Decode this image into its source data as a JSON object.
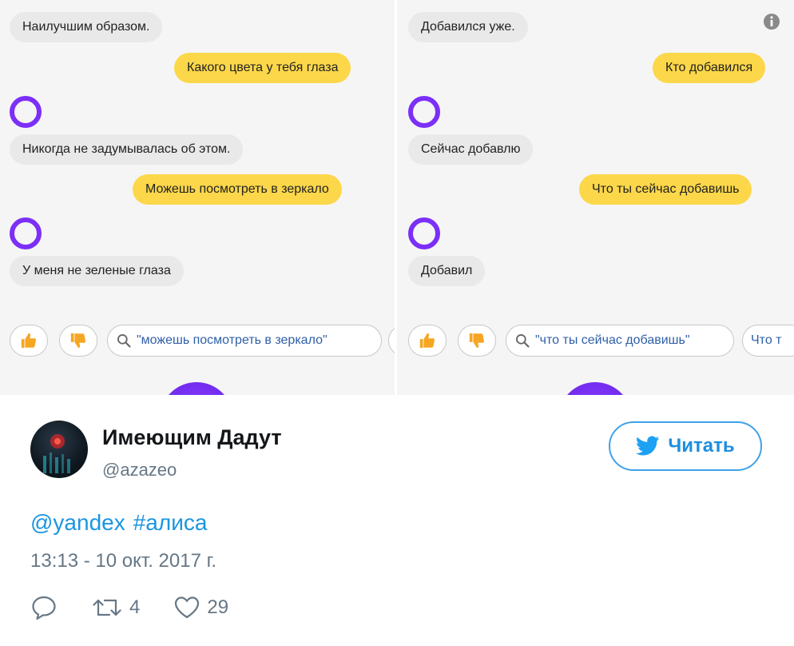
{
  "left_chat": {
    "alice_messages": [
      "Наилучшим образом.",
      "Никогда не задумывалась об этом.",
      "У меня не зеленые глаза"
    ],
    "user_messages": [
      "Какого цвета у тебя глаза",
      "Можешь посмотреть в зеркало"
    ],
    "suggestion": "\"можешь посмотреть в зеркало\""
  },
  "right_chat": {
    "alice_messages": [
      "Добавился уже.",
      "Сейчас добавлю",
      "Добавил"
    ],
    "user_messages": [
      "Кто добавился",
      "Что ты сейчас добавишь"
    ],
    "suggestion": "\"что ты сейчас добавишь\"",
    "suggestion_2": "Что т"
  },
  "colors": {
    "alice_bubble": "#e9e9e9",
    "user_bubble": "#fcd749",
    "alice_accent": "#7b2ff7",
    "link": "#1b95e0",
    "follow": "#3ea2e8"
  },
  "tweet": {
    "display_name": "Имеющим Дадут",
    "handle": "@azazeo",
    "follow_label": "Читать",
    "mention": "@yandex",
    "hashtag": "#алиса",
    "timestamp": "13:13 - 10 окт. 2017 г.",
    "retweets": "4",
    "likes": "29"
  },
  "icons": [
    "alice-icon",
    "thumbs-up-icon",
    "thumbs-down-icon",
    "search-icon",
    "twitter-bird-icon",
    "reply-icon",
    "retweet-icon",
    "heart-icon",
    "info-icon"
  ]
}
